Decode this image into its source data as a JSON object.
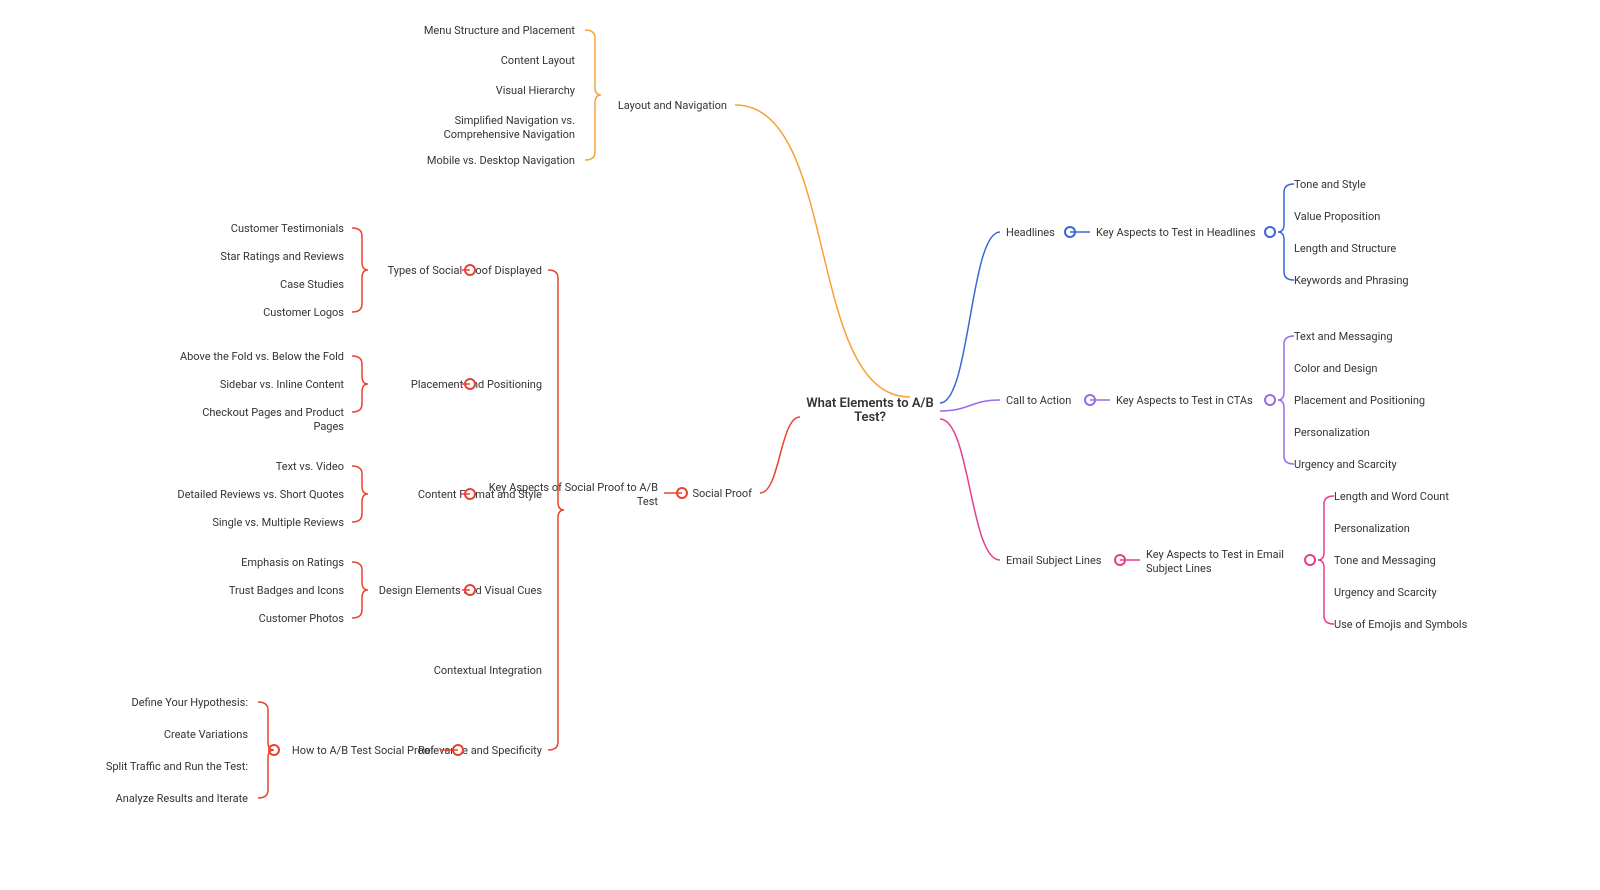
{
  "center": "What Elements to A/B\nTest?",
  "colors": {
    "orange": "#f7a13a",
    "blue": "#3a66d6",
    "purple": "#9a6ae8",
    "pink": "#e33e8e",
    "red": "#e8432e"
  },
  "right": {
    "layout": {
      "label": "Layout and Navigation",
      "items": [
        "Menu Structure and Placement",
        "Content Layout",
        "Visual Hierarchy",
        "Simplified Navigation vs.\nComprehensive Navigation",
        "Mobile vs. Desktop Navigation"
      ]
    },
    "headlines": {
      "label": "Headlines",
      "sub": "Key Aspects to Test in Headlines",
      "items": [
        "Tone and Style",
        "Value Proposition",
        "Length and Structure",
        "Keywords and Phrasing"
      ]
    },
    "cta": {
      "label": "Call to Action",
      "sub": "Key Aspects to Test in CTAs",
      "items": [
        "Text and Messaging",
        "Color and Design",
        "Placement and Positioning",
        "Personalization",
        "Urgency and Scarcity"
      ]
    },
    "email": {
      "label": "Email Subject Lines",
      "sub": "Key Aspects to Test in Email\nSubject Lines",
      "items": [
        "Length and Word Count",
        "Personalization",
        "Tone and Messaging",
        "Urgency and Scarcity",
        "Use of Emojis and Symbols"
      ]
    }
  },
  "left": {
    "social": {
      "label": "Social Proof",
      "sub": "Key Aspects of Social Proof to A/B\nTest",
      "groups": {
        "types": {
          "label": "Types of Social Proof Displayed",
          "items": [
            "Customer Testimonials",
            "Star Ratings and Reviews",
            "Case Studies",
            "Customer Logos"
          ]
        },
        "placement": {
          "label": "Placement and Positioning",
          "items": [
            "Above the Fold vs. Below the Fold",
            "Sidebar vs. Inline Content",
            "Checkout Pages and Product\nPages"
          ]
        },
        "format": {
          "label": "Content Format and Style",
          "items": [
            "Text vs. Video",
            "Detailed Reviews vs. Short Quotes",
            "Single vs. Multiple Reviews"
          ]
        },
        "design": {
          "label": "Design Elements and Visual Cues",
          "items": [
            "Emphasis on Ratings",
            "Trust Badges and Icons",
            "Customer Photos"
          ]
        },
        "context": {
          "label": "Contextual Integration"
        },
        "relevance": {
          "label": "Relevance and Specificity"
        },
        "howto": {
          "label": "How to A/B Test Social Proof",
          "items": [
            "Define Your Hypothesis:",
            "Create Variations",
            "Split Traffic and Run the Test:",
            "Analyze Results and Iterate"
          ]
        }
      }
    }
  }
}
